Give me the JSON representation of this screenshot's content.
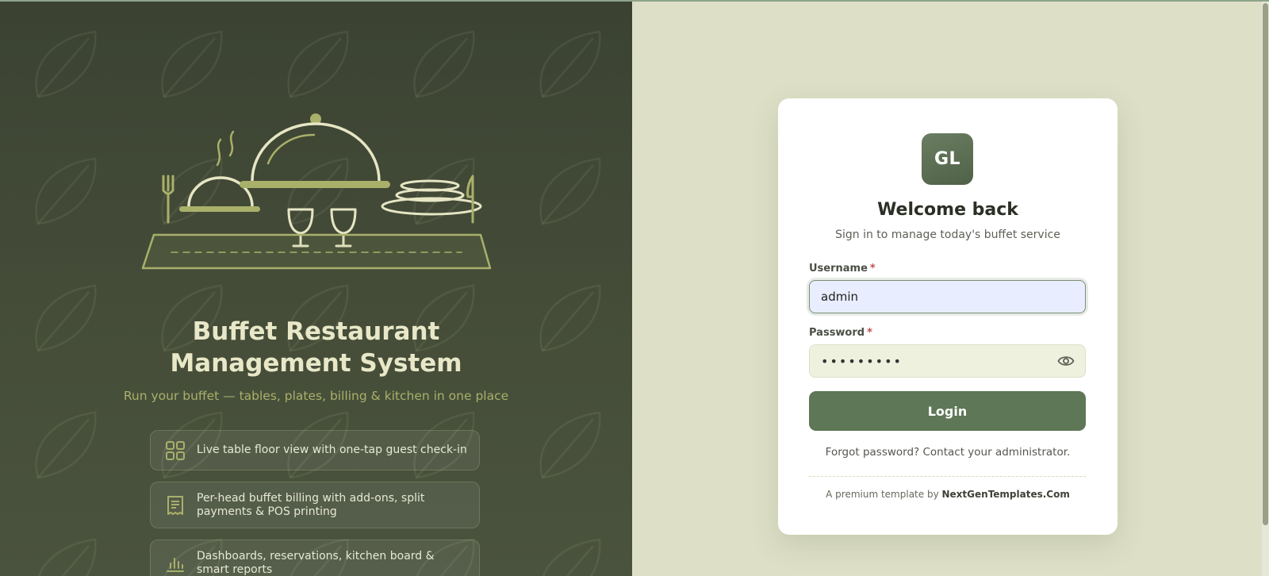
{
  "brand": {
    "title_line1": "Buffet Restaurant",
    "title_line2": "Management System",
    "tagline": "Run your buffet — tables, plates, billing & kitchen in one place"
  },
  "features": [
    {
      "icon": "grid-icon",
      "text": "Live table floor view with one-tap guest check-in"
    },
    {
      "icon": "receipt-icon",
      "text": "Per-head buffet billing with add-ons, split payments & POS printing"
    },
    {
      "icon": "bar-chart-icon",
      "text": "Dashboards, reservations, kitchen board & smart reports"
    }
  ],
  "login": {
    "logo_text": "GL",
    "welcome": "Welcome back",
    "subtitle": "Sign in to manage today's buffet service",
    "username_label": "Username",
    "username_value": "admin",
    "password_label": "Password",
    "password_value": "admin1234",
    "required_mark": "*",
    "login_button": "Login",
    "forgot": "Forgot password? Contact your administrator.",
    "credit_prefix": "A premium template by",
    "credit_brand": "NextGenTemplates.Com"
  },
  "colors": {
    "left_panel": "#3f4635",
    "right_bg": "#dde0c6",
    "accent": "#5e7756",
    "title_cream": "#e8e8c8",
    "tagline_olive": "#a9b06a"
  }
}
